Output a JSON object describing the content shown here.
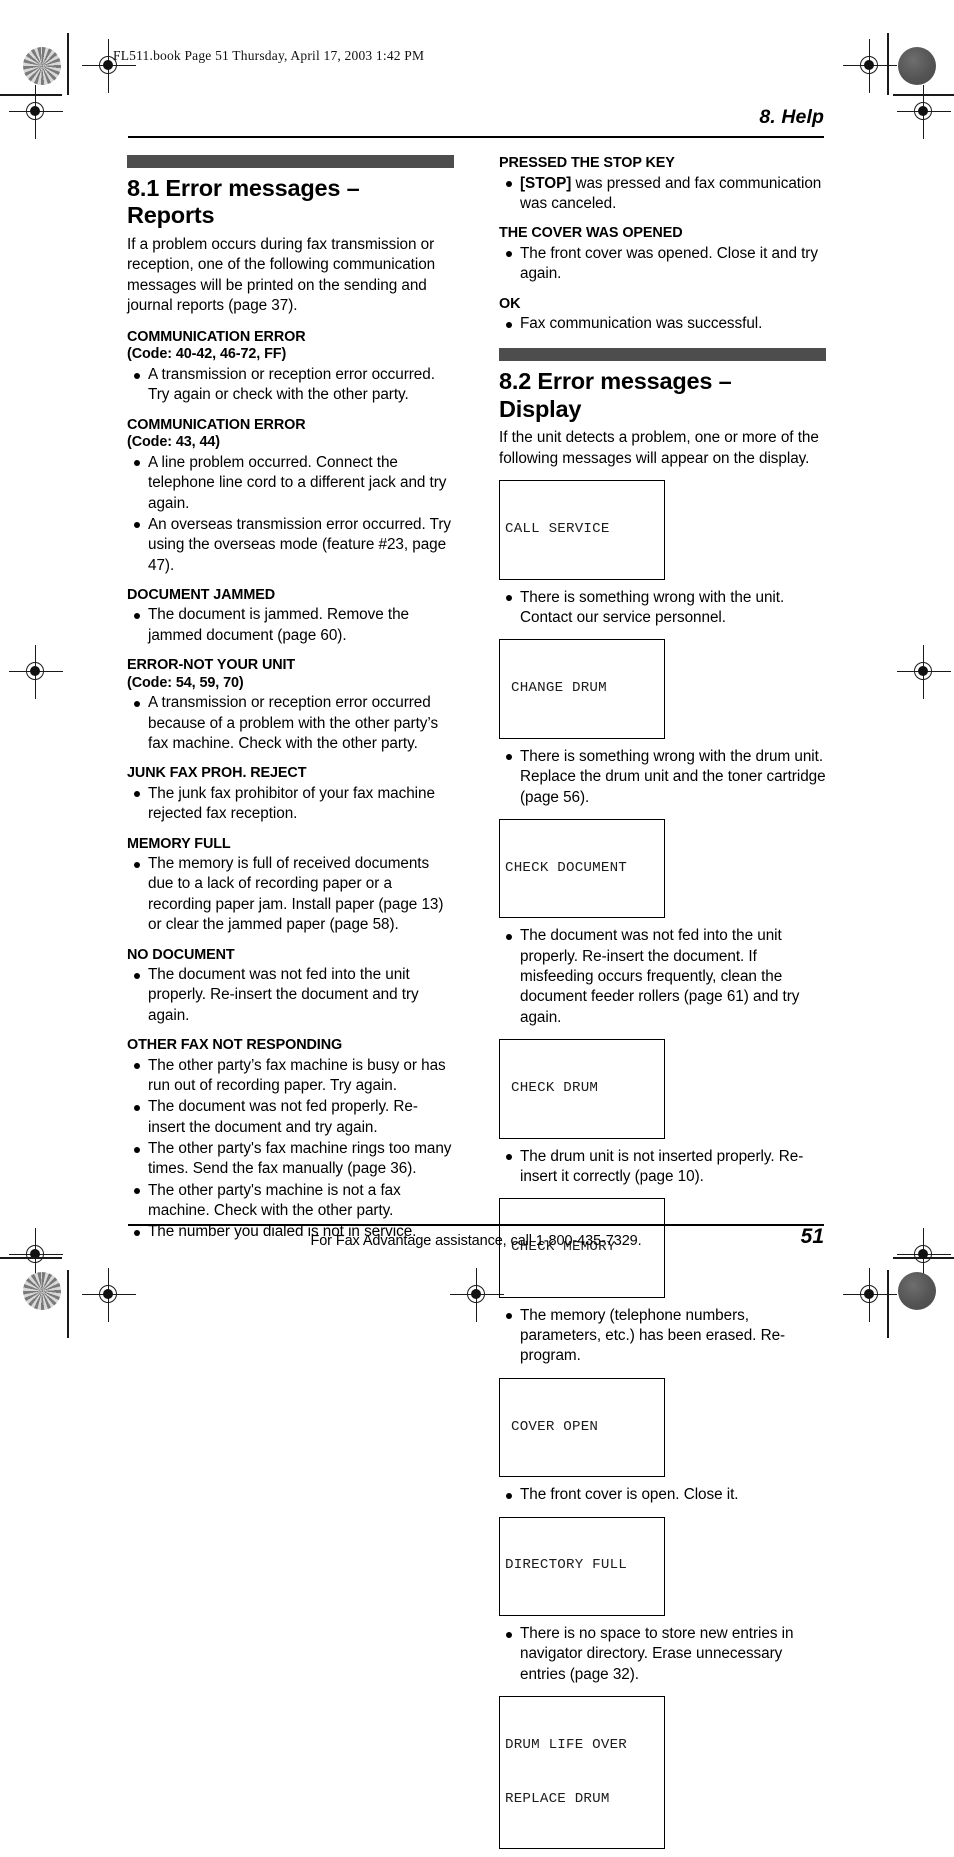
{
  "print_marks": {
    "book_line": "FL511.book  Page 51  Thursday, April 17, 2003  1:42 PM",
    "edge_label": "FL511"
  },
  "running_head": "8. Help",
  "footer": {
    "assistance": "For Fax Advantage assistance, call 1-800-435-7329.",
    "page_number": "51"
  },
  "colors": {
    "section_bar": "#4d4d4d",
    "text": "#000000"
  },
  "left_column": {
    "section": {
      "number_title": "8.1 Error messages – Reports",
      "title_line1": "8.1 Error messages –",
      "title_line2": "Reports",
      "intro": "If a problem occurs during fax transmission or reception, one of the following communication messages will be printed on the sending and journal reports (page 37)."
    },
    "messages": [
      {
        "name": "COMMUNICATION ERROR",
        "code": "(Code: 40-42, 46-72, FF)",
        "bullets": [
          "A transmission or reception error occurred. Try again or check with the other party."
        ]
      },
      {
        "name": "COMMUNICATION ERROR",
        "code": "(Code: 43, 44)",
        "bullets": [
          "A line problem occurred. Connect the telephone line cord to a different jack and try again.",
          "An overseas transmission error occurred. Try using the overseas mode (feature #23, page 47)."
        ]
      },
      {
        "name": "DOCUMENT JAMMED",
        "code": "",
        "bullets": [
          "The document is jammed. Remove the jammed document (page 60)."
        ]
      },
      {
        "name": "ERROR-NOT YOUR UNIT",
        "code": "(Code: 54, 59, 70)",
        "bullets": [
          "A transmission or reception error occurred because of a problem with the other party’s fax machine. Check with the other party."
        ]
      },
      {
        "name": "JUNK FAX PROH. REJECT",
        "code": "",
        "bullets": [
          "The junk fax prohibitor of your fax machine rejected fax reception."
        ]
      },
      {
        "name": "MEMORY FULL",
        "code": "",
        "bullets": [
          "The memory is full of received documents due to a lack of recording paper or a recording paper jam. Install paper (page 13) or clear the jammed paper (page 58)."
        ]
      },
      {
        "name": "NO DOCUMENT",
        "code": "",
        "bullets": [
          "The document was not fed into the unit properly. Re-insert the document and try again."
        ]
      },
      {
        "name": "OTHER FAX NOT RESPONDING",
        "code": "",
        "bullets": [
          "The other party’s fax machine is busy or has run out of recording paper. Try again.",
          "The document was not fed properly. Re-insert the document and try again.",
          "The other party's fax machine rings too many times. Send the fax manually (page 36).",
          "The other party's machine is not a fax machine. Check with the other party.",
          "The number you dialed is not in service."
        ]
      }
    ]
  },
  "right_column": {
    "continued_messages": [
      {
        "name": "PRESSED THE STOP KEY",
        "code": "",
        "key_prefix": "[STOP]",
        "bullets": [
          " was pressed and fax communication was canceled."
        ]
      },
      {
        "name": "THE COVER WAS OPENED",
        "code": "",
        "bullets": [
          "The front cover was opened. Close it and try again."
        ]
      },
      {
        "name": "OK",
        "code": "",
        "bullets": [
          "Fax communication was successful."
        ]
      }
    ],
    "section": {
      "number_title": "8.2 Error messages – Display",
      "title_line1": "8.2 Error messages –",
      "title_line2": "Display",
      "intro": "If the unit detects a problem, one or more of the following messages will appear on the display."
    },
    "display_messages": [
      {
        "lcd_lines": [
          "CALL SERVICE"
        ],
        "lcd_align": "flush",
        "bullets": [
          "There is something wrong with the unit. Contact our service personnel."
        ]
      },
      {
        "lcd_lines": [
          "CHANGE DRUM"
        ],
        "lcd_align": "indent",
        "bullets": [
          "There is something wrong with the drum unit. Replace the drum unit and the toner cartridge (page 56)."
        ]
      },
      {
        "lcd_lines": [
          "CHECK DOCUMENT"
        ],
        "lcd_align": "flush",
        "bullets": [
          "The document was not fed into the unit properly. Re-insert the document. If misfeeding occurs frequently, clean the document feeder rollers (page 61) and try again."
        ]
      },
      {
        "lcd_lines": [
          "CHECK DRUM"
        ],
        "lcd_align": "indent",
        "bullets": [
          "The drum unit is not inserted properly. Re-insert it correctly (page 10)."
        ]
      },
      {
        "lcd_lines": [
          "CHECK MEMORY"
        ],
        "lcd_align": "indent",
        "bullets": [
          "The memory (telephone numbers, parameters, etc.) has been erased. Re-program."
        ]
      },
      {
        "lcd_lines": [
          "COVER OPEN"
        ],
        "lcd_align": "indent",
        "bullets": [
          "The front cover is open. Close it."
        ]
      },
      {
        "lcd_lines": [
          "DIRECTORY FULL"
        ],
        "lcd_align": "flush",
        "bullets": [
          "There is no space to store new entries in navigator directory. Erase unnecessary entries (page 32)."
        ]
      },
      {
        "lcd_lines": [
          "DRUM LIFE OVER",
          "REPLACE DRUM"
        ],
        "lcd_align": "flush",
        "bullets": []
      }
    ]
  }
}
